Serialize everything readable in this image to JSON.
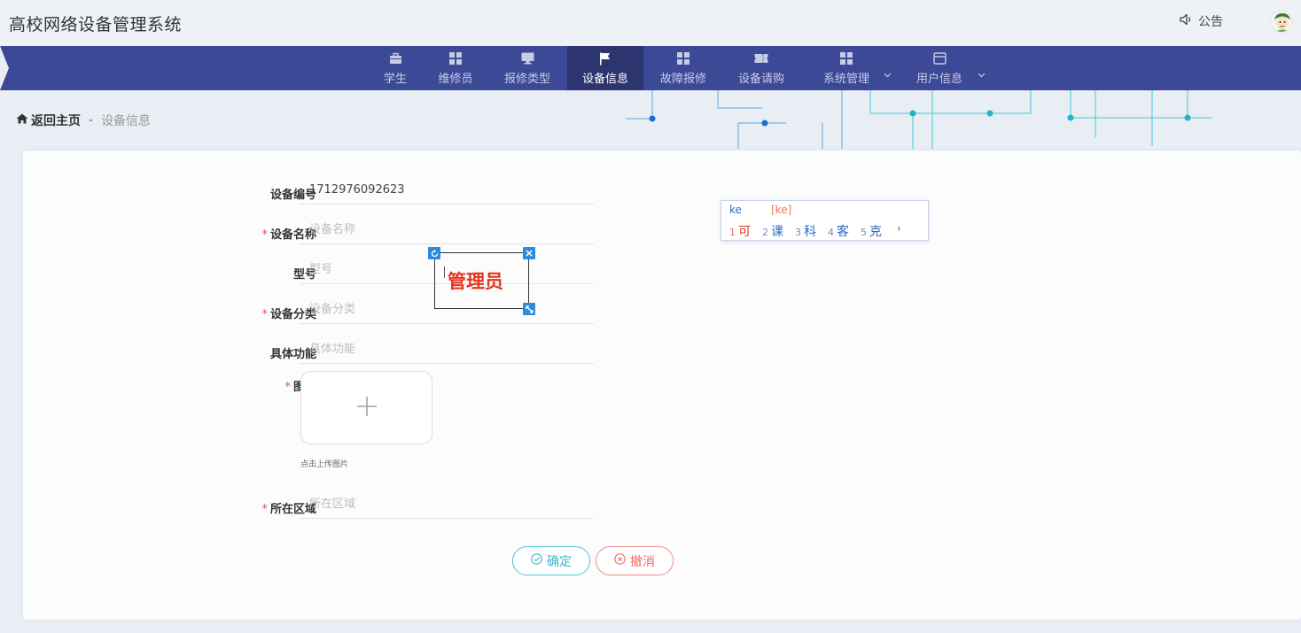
{
  "app": {
    "title": "高校网络设备管理系统"
  },
  "header": {
    "notice_label": "公告"
  },
  "nav": {
    "items": [
      {
        "label": "学生",
        "icon": "briefcase-icon"
      },
      {
        "label": "维修员",
        "icon": "grid-icon"
      },
      {
        "label": "报修类型",
        "icon": "monitor-icon"
      },
      {
        "label": "设备信息",
        "icon": "flag-icon",
        "active": true
      },
      {
        "label": "故障报修",
        "icon": "grid-icon"
      },
      {
        "label": "设备请购",
        "icon": "ticket-icon"
      },
      {
        "label": "系统管理",
        "icon": "grid-icon",
        "has_dropdown": true
      },
      {
        "label": "用户信息",
        "icon": "window-icon",
        "has_dropdown": true
      }
    ]
  },
  "breadcrumb": {
    "home_label": "返回主页",
    "separator": "-",
    "current": "设备信息"
  },
  "form": {
    "fields": [
      {
        "label": "设备编号",
        "required": false,
        "value": "1712976092623",
        "placeholder": ""
      },
      {
        "label": "设备名称",
        "required": true,
        "value": "",
        "placeholder": "设备名称"
      },
      {
        "label": "型号",
        "required": false,
        "value": "",
        "placeholder": "型号"
      },
      {
        "label": "设备分类",
        "required": true,
        "value": "",
        "placeholder": "设备分类"
      },
      {
        "label": "具体功能",
        "required": false,
        "value": "",
        "placeholder": "具体功能"
      },
      {
        "label": "所在区域",
        "required": true,
        "value": "",
        "placeholder": "所在区域"
      }
    ],
    "image": {
      "label": "图片",
      "required": true,
      "hint": "点击上传图片"
    },
    "required_mark": "*",
    "confirm_label": "确定",
    "cancel_label": "撤消"
  },
  "watermark": {
    "text": "管理员"
  },
  "ime": {
    "composition": "ke",
    "pinyin": "[ke]",
    "candidates": [
      {
        "num": "1",
        "text": "可"
      },
      {
        "num": "2",
        "text": "课"
      },
      {
        "num": "3",
        "text": "科"
      },
      {
        "num": "4",
        "text": "客"
      },
      {
        "num": "5",
        "text": "克"
      }
    ],
    "next_glyph": "›"
  },
  "colors": {
    "navbar": "#3b4996",
    "nav_active": "#2c356f",
    "required": "#e05555",
    "confirm": "#3bb6cc",
    "cancel": "#ee6b64",
    "watermark_text": "#e8331f"
  }
}
